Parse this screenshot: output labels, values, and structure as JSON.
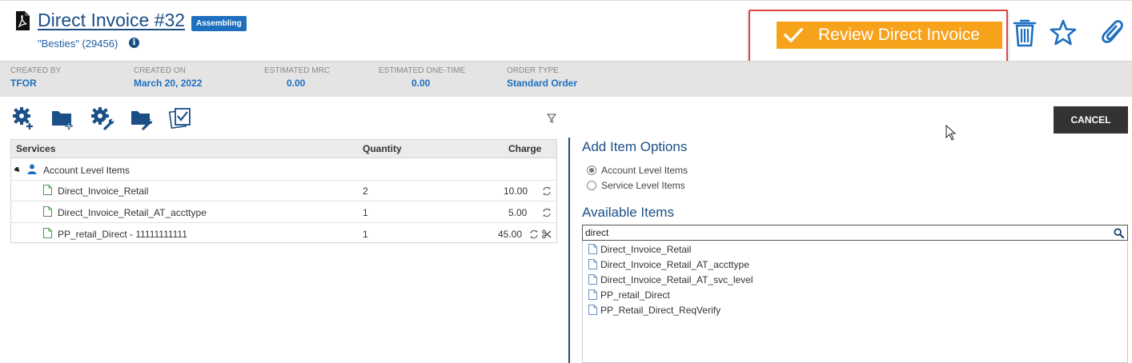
{
  "header": {
    "title": "Direct Invoice #32",
    "status": "Assembling",
    "customer": "\"Besties\" (29456)",
    "info_glyph": "i",
    "review_label": "Review Direct Invoice",
    "icons": [
      "pdf-icon",
      "check-icon",
      "trash-icon",
      "star-icon",
      "paperclip-icon"
    ]
  },
  "meta": [
    {
      "label": "CREATED BY",
      "value": "TFOR"
    },
    {
      "label": "CREATED ON",
      "value": "March 20, 2022"
    },
    {
      "label": "ESTIMATED MRC",
      "value": "0.00"
    },
    {
      "label": "ESTIMATED ONE-TIME",
      "value": "0.00"
    },
    {
      "label": "ORDER TYPE",
      "value": "Standard Order"
    }
  ],
  "toolbar": {
    "icons": [
      "add-service-gear-icon",
      "add-folder-icon",
      "configure-gear-icon",
      "folder-wrench-icon",
      "checklist-icon",
      "filter-icon"
    ],
    "cancel_label": "CANCEL"
  },
  "services": {
    "columns": [
      "Services",
      "Quantity",
      "Charge"
    ],
    "group": "Account Level Items",
    "rows": [
      {
        "name": "Direct_Invoice_Retail",
        "quantity": "2",
        "charge": "10.00"
      },
      {
        "name": "Direct_Invoice_Retail_AT_accttype",
        "quantity": "1",
        "charge": "5.00"
      },
      {
        "name": "PP_retail_Direct - 11111111111",
        "quantity": "1",
        "charge": "45.00"
      }
    ]
  },
  "add_options": {
    "title": "Add Item Options",
    "options": [
      "Account Level Items",
      "Service Level Items"
    ],
    "selected": "Account Level Items"
  },
  "available": {
    "title": "Available Items",
    "search_value": "direct",
    "items": [
      "Direct_Invoice_Retail",
      "Direct_Invoice_Retail_AT_accttype",
      "Direct_Invoice_Retail_AT_svc_level",
      "PP_retail_Direct",
      "PP_Retail_Direct_ReqVerify"
    ]
  },
  "colors": {
    "brand": "#1b4f86",
    "link": "#1e6fbf",
    "review": "#f7a21b",
    "highlight": "#e04545",
    "cancel": "#333333"
  }
}
